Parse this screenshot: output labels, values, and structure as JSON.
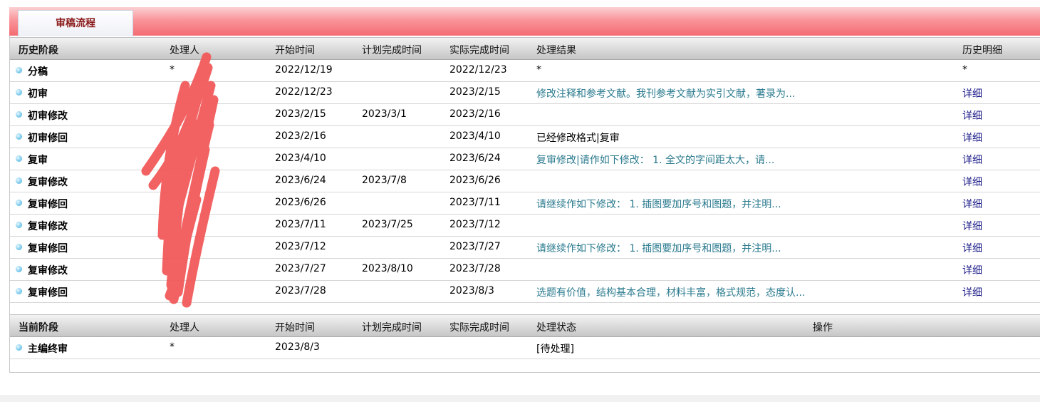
{
  "header": {
    "tab_label": "审稿流程"
  },
  "history": {
    "columns": [
      "历史阶段",
      "处理人",
      "开始时间",
      "计划完成时间",
      "实际完成时间",
      "处理结果",
      "历史明细"
    ],
    "rows": [
      {
        "stage": "分稿",
        "handler": "*",
        "start": "2022/12/19",
        "planned": "",
        "actual": "2022/12/23",
        "result": "*",
        "result_style": "plain",
        "detail": "*"
      },
      {
        "stage": "初审",
        "handler": "",
        "start": "2022/12/23",
        "planned": "",
        "actual": "2023/2/15",
        "result": "修改注释和参考文献。我刊参考文献为实引文献，著录为...",
        "result_style": "teal",
        "detail": "详细"
      },
      {
        "stage": "初审修改",
        "handler": "",
        "start": "2023/2/15",
        "planned": "2023/3/1",
        "actual": "2023/2/16",
        "result": "",
        "result_style": "plain",
        "detail": "详细"
      },
      {
        "stage": "初审修回",
        "handler": "",
        "start": "2023/2/16",
        "planned": "",
        "actual": "2023/4/10",
        "result": "已经修改格式|复审",
        "result_style": "plain",
        "detail": "详细"
      },
      {
        "stage": "复审",
        "handler": "",
        "start": "2023/4/10",
        "planned": "",
        "actual": "2023/6/24",
        "result": "复审修改|请作如下修改： 1. 全文的字间距太大，请...",
        "result_style": "teal",
        "detail": "详细"
      },
      {
        "stage": "复审修改",
        "handler": "",
        "start": "2023/6/24",
        "planned": "2023/7/8",
        "actual": "2023/6/26",
        "result": "",
        "result_style": "plain",
        "detail": "详细"
      },
      {
        "stage": "复审修回",
        "handler": "",
        "start": "2023/6/26",
        "planned": "",
        "actual": "2023/7/11",
        "result": "请继续作如下修改： 1. 插图要加序号和图题，并注明...",
        "result_style": "teal",
        "detail": "详细"
      },
      {
        "stage": "复审修改",
        "handler": "",
        "start": "2023/7/11",
        "planned": "2023/7/25",
        "actual": "2023/7/12",
        "result": "",
        "result_style": "plain",
        "detail": "详细"
      },
      {
        "stage": "复审修回",
        "handler": "",
        "start": "2023/7/12",
        "planned": "",
        "actual": "2023/7/27",
        "result": "请继续作如下修改： 1. 插图要加序号和图题，并注明...",
        "result_style": "teal",
        "detail": "详细"
      },
      {
        "stage": "复审修改",
        "handler": "",
        "start": "2023/7/27",
        "planned": "2023/8/10",
        "actual": "2023/7/28",
        "result": "",
        "result_style": "plain",
        "detail": "详细"
      },
      {
        "stage": "复审修回",
        "handler": "",
        "start": "2023/7/28",
        "planned": "",
        "actual": "2023/8/3",
        "result": "选题有价值，结构基本合理，材料丰富，格式规范，态度认...",
        "result_style": "teal",
        "detail": "详细"
      }
    ]
  },
  "current": {
    "columns": [
      "当前阶段",
      "处理人",
      "开始时间",
      "计划完成时间",
      "实际完成时间",
      "处理状态",
      "操作"
    ],
    "rows": [
      {
        "stage": "主编终审",
        "handler": "*",
        "start": "2023/8/3",
        "planned": "",
        "actual": "",
        "status": "[待处理]"
      }
    ]
  },
  "colors": {
    "teal_text": "#2a7a8e",
    "link_text": "#1b1b8a",
    "tab_text": "#8b1a1a",
    "redaction": "#f25a5a"
  },
  "icons": {
    "row_bullet": "dot-bullet-icon"
  }
}
